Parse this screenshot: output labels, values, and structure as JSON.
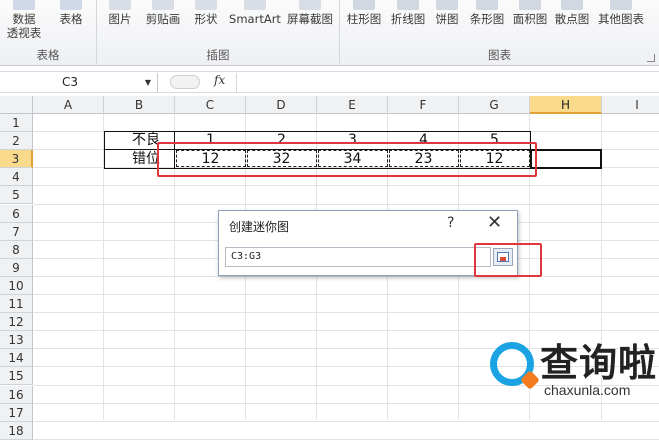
{
  "ribbon": {
    "groups": [
      {
        "label": "表格",
        "buttons": [
          "数据\n透视表",
          "表格"
        ]
      },
      {
        "label": "插图",
        "buttons": [
          "图片",
          "剪贴画",
          "形状",
          "SmartArt",
          "屏幕截图"
        ]
      },
      {
        "label": "图表",
        "buttons": [
          "柱形图",
          "折线图",
          "饼图",
          "条形图",
          "面积图",
          "散点图",
          "其他图表"
        ]
      }
    ]
  },
  "formula_bar": {
    "name_box": "C3",
    "fx": "fx",
    "formula": ""
  },
  "columns": [
    "A",
    "B",
    "C",
    "D",
    "E",
    "F",
    "G",
    "H",
    "I"
  ],
  "rows": [
    "1",
    "2",
    "3",
    "4",
    "5",
    "6",
    "7",
    "8",
    "9",
    "10",
    "11",
    "12",
    "13",
    "14",
    "15",
    "16",
    "17",
    "18"
  ],
  "sheet": {
    "row2": {
      "label": "不良",
      "values": [
        "1",
        "2",
        "3",
        "4",
        "5"
      ]
    },
    "row3": {
      "label": "错位",
      "values": [
        "12",
        "32",
        "34",
        "23",
        "12"
      ]
    }
  },
  "dialog": {
    "title": "创建迷你图",
    "help": "?",
    "close": "✕",
    "range_value": "C3:G3"
  },
  "watermark": {
    "text": "查询啦",
    "domain": "chaxunla.com"
  },
  "colors": {
    "accent": "#e0373c",
    "selected_header": "#f9d98a",
    "logo_blue": "#1ba4e4"
  }
}
